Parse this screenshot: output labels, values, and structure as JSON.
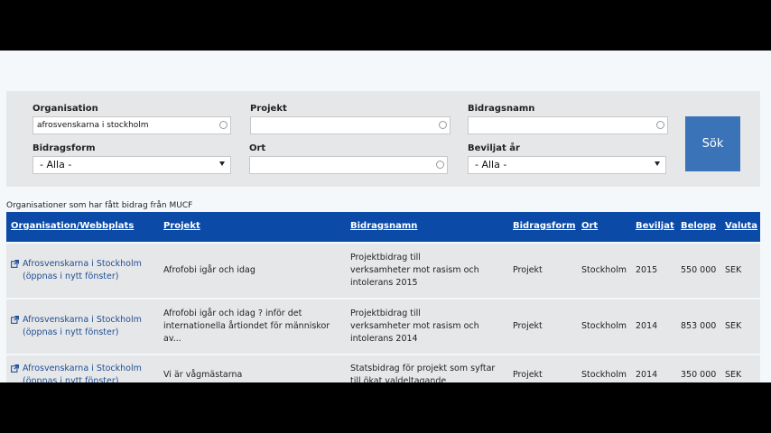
{
  "search": {
    "organisation_label": "Organisation",
    "organisation_value": "afrosvenskarna i stockholm",
    "projekt_label": "Projekt",
    "projekt_value": "",
    "bidragsnamn_label": "Bidragsnamn",
    "bidragsnamn_value": "",
    "bidragsform_label": "Bidragsform",
    "bidragsform_selected": "- Alla -",
    "ort_label": "Ort",
    "ort_value": "",
    "beviljat_label": "Beviljat år",
    "beviljat_selected": "- Alla -",
    "search_button": "Sök"
  },
  "results": {
    "caption": "Organisationer som har fått bidrag från MUCF",
    "columns": [
      "Organisation/Webbplats",
      "Projekt",
      "Bidragsnamn",
      "Bidragsform",
      "Ort",
      "Beviljat",
      "Belopp",
      "Valuta"
    ],
    "rows": [
      {
        "org_line1": "Afrosvenskarna i Stockholm",
        "org_line2": "(öppnas i nytt fönster)",
        "projekt": [
          "Afrofobi igår och idag"
        ],
        "bidragsnamn": [
          "Projektbidrag till",
          "verksamheter mot rasism och",
          "intolerans 2015"
        ],
        "bidragsform": "Projekt",
        "ort": "Stockholm",
        "beviljat": "2015",
        "belopp": "550 000",
        "valuta": "SEK"
      },
      {
        "org_line1": "Afrosvenskarna i Stockholm",
        "org_line2": "(öppnas i nytt fönster)",
        "projekt": [
          "Afrofobi igår och idag ? inför det",
          "internationella årtiondet för människor",
          "av..."
        ],
        "bidragsnamn": [
          "Projektbidrag till",
          "verksamheter mot rasism och",
          "intolerans 2014"
        ],
        "bidragsform": "Projekt",
        "ort": "Stockholm",
        "beviljat": "2014",
        "belopp": "853 000",
        "valuta": "SEK"
      },
      {
        "org_line1": "Afrosvenskarna i Stockholm",
        "org_line2": "(öppnas i nytt fönster)",
        "projekt": [
          "Vi är vågmästarna"
        ],
        "bidragsnamn": [
          "Statsbidrag för projekt som syftar",
          "till ökat valdeltagande"
        ],
        "bidragsform": "Projekt",
        "ort": "Stockholm",
        "beviljat": "2014",
        "belopp": "350 000",
        "valuta": "SEK"
      }
    ]
  },
  "icons": {
    "external_link": "external-link-icon",
    "clear": "clear-circle-icon",
    "dropdown": "caret-down-icon"
  },
  "colors": {
    "header_bg": "#0b4aa7",
    "button_bg": "#3b73b9",
    "link": "#1f4e94"
  }
}
